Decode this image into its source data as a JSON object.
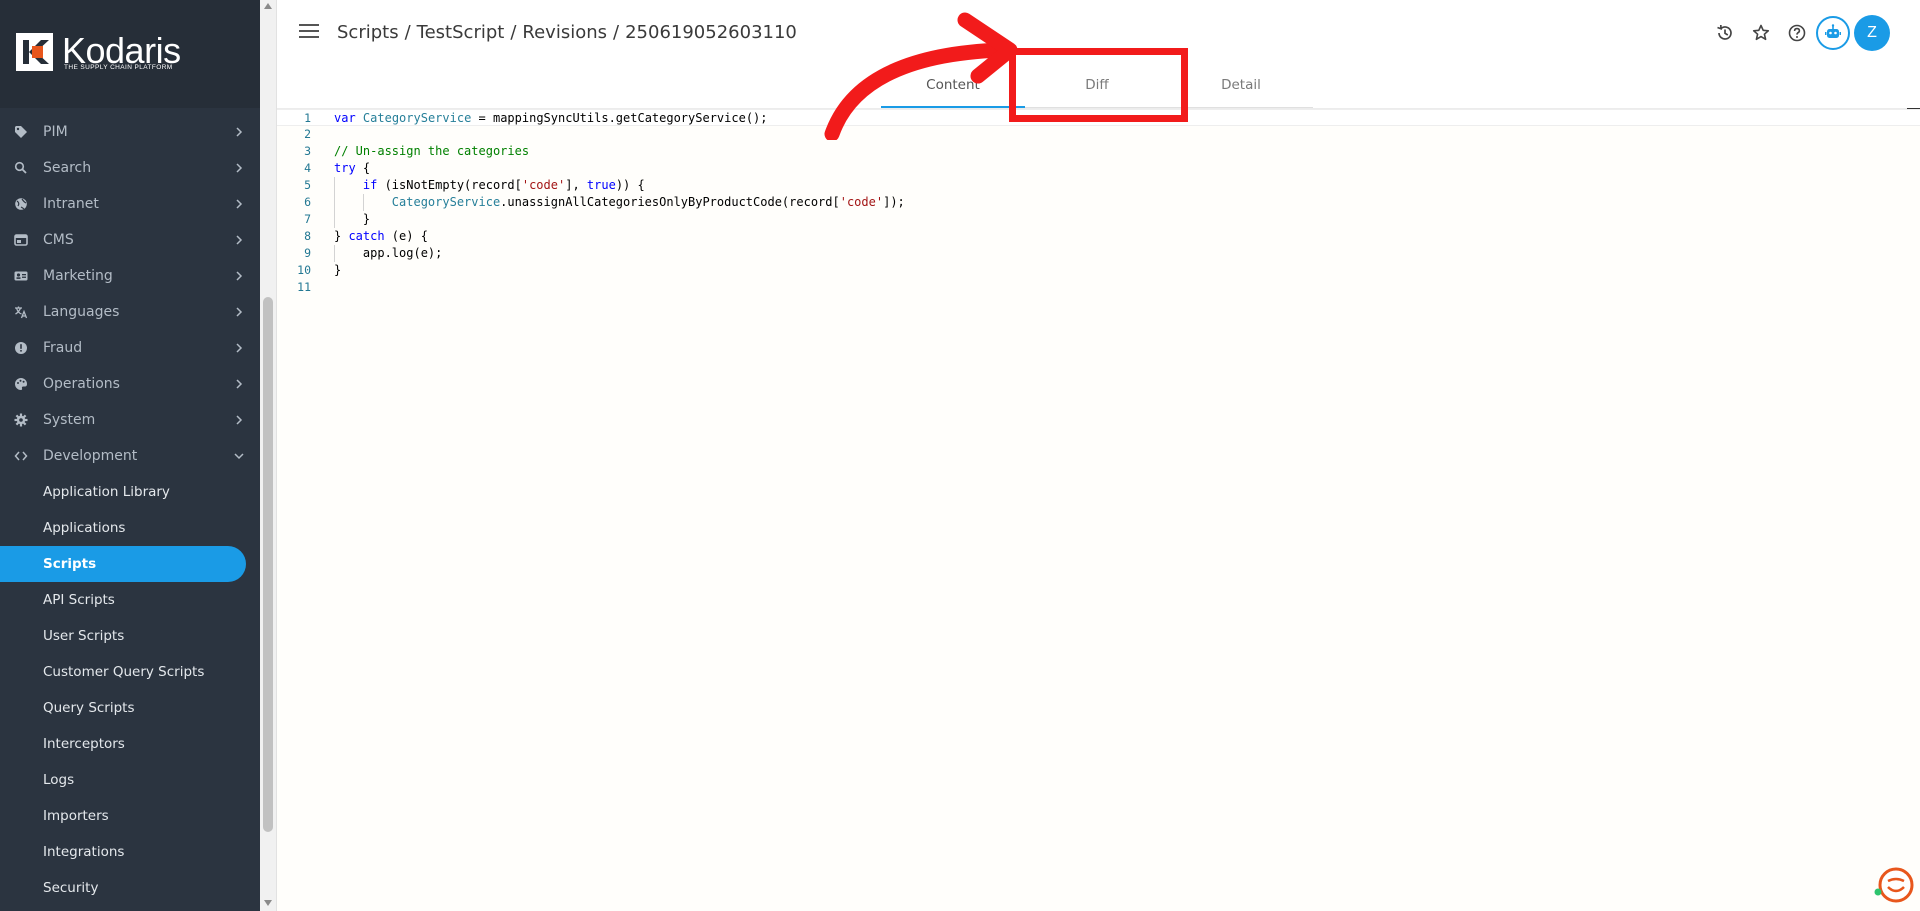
{
  "brand": {
    "name": "Kodaris",
    "tagline": "THE SUPPLY CHAIN PLATFORM",
    "accent": "#1a9be6",
    "sidebar_bg": "#2b3440"
  },
  "sidebar": {
    "items": [
      {
        "label": "PIM",
        "icon": "tag-icon"
      },
      {
        "label": "Search",
        "icon": "search-icon"
      },
      {
        "label": "Intranet",
        "icon": "globe-icon"
      },
      {
        "label": "CMS",
        "icon": "window-icon"
      },
      {
        "label": "Marketing",
        "icon": "id-card-icon"
      },
      {
        "label": "Languages",
        "icon": "translate-icon"
      },
      {
        "label": "Fraud",
        "icon": "alert-icon"
      },
      {
        "label": "Operations",
        "icon": "palette-icon"
      },
      {
        "label": "System",
        "icon": "gear-icon"
      },
      {
        "label": "Development",
        "icon": "code-icon"
      }
    ],
    "dev_sub_items": [
      {
        "label": "Application Library"
      },
      {
        "label": "Applications"
      },
      {
        "label": "Scripts",
        "active": true
      },
      {
        "label": "API Scripts"
      },
      {
        "label": "User Scripts"
      },
      {
        "label": "Customer Query Scripts"
      },
      {
        "label": "Query Scripts"
      },
      {
        "label": "Interceptors"
      },
      {
        "label": "Logs"
      },
      {
        "label": "Importers"
      },
      {
        "label": "Integrations"
      },
      {
        "label": "Security"
      }
    ]
  },
  "header": {
    "breadcrumb": [
      "Scripts",
      "TestScript",
      "Revisions",
      "250619052603110"
    ],
    "avatar_initial": "Z",
    "icons": [
      "history-icon",
      "star-icon",
      "help-icon",
      "robot-icon"
    ]
  },
  "tabs": [
    {
      "label": "Content",
      "active": true
    },
    {
      "label": "Diff",
      "active": false
    },
    {
      "label": "Detail",
      "active": false
    }
  ],
  "editor": {
    "line_numbers": [
      "1",
      "2",
      "3",
      "4",
      "5",
      "6",
      "7",
      "8",
      "9",
      "10",
      "11"
    ]
  }
}
